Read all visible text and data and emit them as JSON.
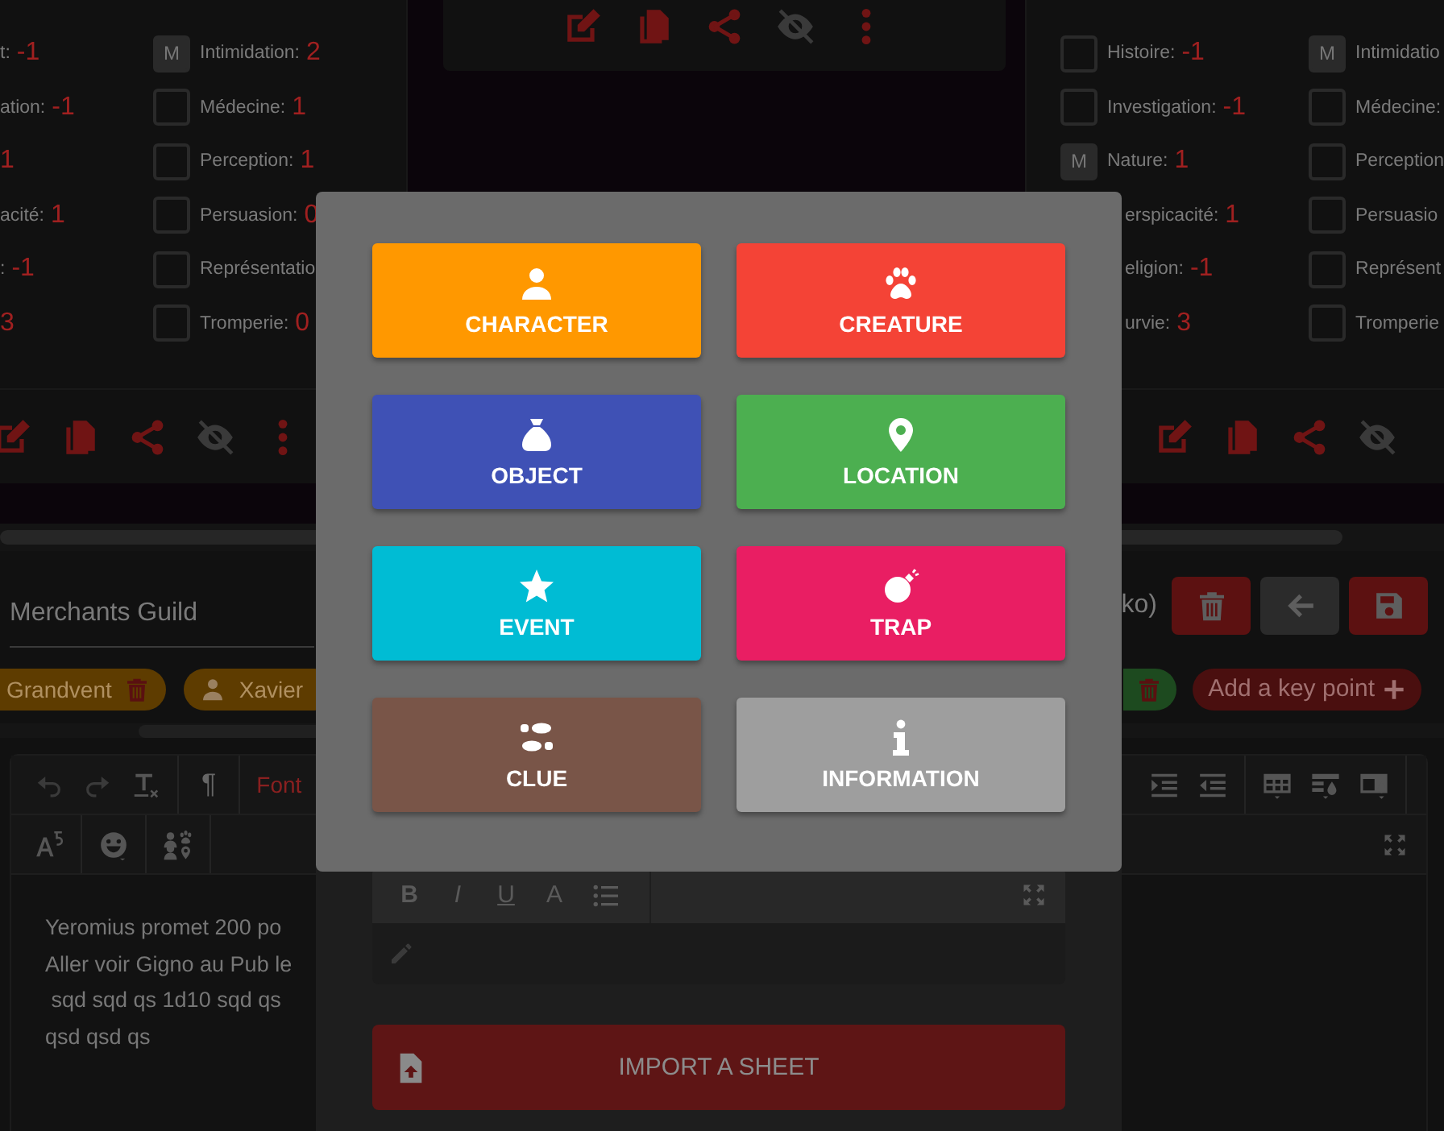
{
  "left_card": {
    "columns": [
      [
        {
          "kind": "text",
          "label": "t:",
          "value": "-1"
        },
        {
          "kind": "text",
          "label": "ation:",
          "value": "-1"
        },
        {
          "kind": "text",
          "value": "1"
        },
        {
          "kind": "text",
          "label": "acité:",
          "value": "1"
        },
        {
          "kind": "text",
          "label": ":",
          "value": "-1"
        },
        {
          "kind": "text",
          "value": "3"
        }
      ],
      [
        {
          "kind": "checkbox",
          "checked": true,
          "badge": "M",
          "label": "Intimidation:",
          "value": "2"
        },
        {
          "kind": "checkbox",
          "checked": false,
          "label": "Médecine:",
          "value": "1"
        },
        {
          "kind": "checkbox",
          "checked": false,
          "label": "Perception:",
          "value": "1"
        },
        {
          "kind": "checkbox",
          "checked": false,
          "label": "Persuasion:",
          "value": "0"
        },
        {
          "kind": "checkbox",
          "checked": false,
          "label": "Représentatio"
        },
        {
          "kind": "checkbox",
          "checked": false,
          "label": "Tromperie:",
          "value": "0"
        }
      ]
    ]
  },
  "right_card": {
    "columns": [
      [
        {
          "kind": "checkbox",
          "checked": false,
          "label": "Histoire:",
          "value": "-1"
        },
        {
          "kind": "checkbox",
          "checked": false,
          "label": "Investigation:",
          "value": "-1"
        },
        {
          "kind": "checkbox",
          "checked": true,
          "badge": "M",
          "label": "Nature:",
          "value": "1"
        },
        {
          "kind": "text",
          "label": "erspicacité:",
          "value": "1"
        },
        {
          "kind": "text",
          "label": "eligion:",
          "value": "-1"
        },
        {
          "kind": "text",
          "label": "urvie:",
          "value": "3"
        }
      ],
      [
        {
          "kind": "checkbox",
          "checked": true,
          "badge": "M",
          "label": "Intimidatio"
        },
        {
          "kind": "checkbox",
          "checked": false,
          "label": "Médecine:"
        },
        {
          "kind": "checkbox",
          "checked": false,
          "label": "Perception"
        },
        {
          "kind": "checkbox",
          "checked": false,
          "label": "Persuasio"
        },
        {
          "kind": "checkbox",
          "checked": false,
          "label": "Représent"
        },
        {
          "kind": "checkbox",
          "checked": false,
          "label": "Tromperie"
        }
      ]
    ]
  },
  "document": {
    "title": "Merchants Guild",
    "size": "ko)",
    "chips": [
      {
        "kind": "plain",
        "label": "Grandvent",
        "color": "#5e3c00"
      },
      {
        "kind": "person",
        "label": "Xavier",
        "color": "#5e3c00"
      },
      {
        "kind": "bare",
        "color": "#1d4a1f"
      }
    ],
    "add_key_point": "Add a key point"
  },
  "editor": {
    "paragraph": "¶",
    "font_menu": "Font",
    "lines": [
      "Yeromius promet 200 po",
      "Aller voir Gigno au Pub le",
      " sqd sqd qs 1d10 sqd qs",
      "qsd qsd qs"
    ]
  },
  "note_editor": {
    "format_buttons": [
      "B",
      "I",
      "U",
      "A"
    ]
  },
  "import_button": "IMPORT A SHEET",
  "categories": [
    {
      "kind": "character",
      "label": "CHARACTER",
      "color": "#ff9800"
    },
    {
      "kind": "creature",
      "label": "CREATURE",
      "color": "#f44336"
    },
    {
      "kind": "object",
      "label": "OBJECT",
      "color": "#3f51b5"
    },
    {
      "kind": "location",
      "label": "LOCATION",
      "color": "#4caf50"
    },
    {
      "kind": "event",
      "label": "EVENT",
      "color": "#00bcd4"
    },
    {
      "kind": "trap",
      "label": "TRAP",
      "color": "#e91e63"
    },
    {
      "kind": "clue",
      "label": "CLUE",
      "color": "#795548"
    },
    {
      "kind": "information",
      "label": "INFORMATION",
      "color": "#9e9e9e"
    }
  ]
}
